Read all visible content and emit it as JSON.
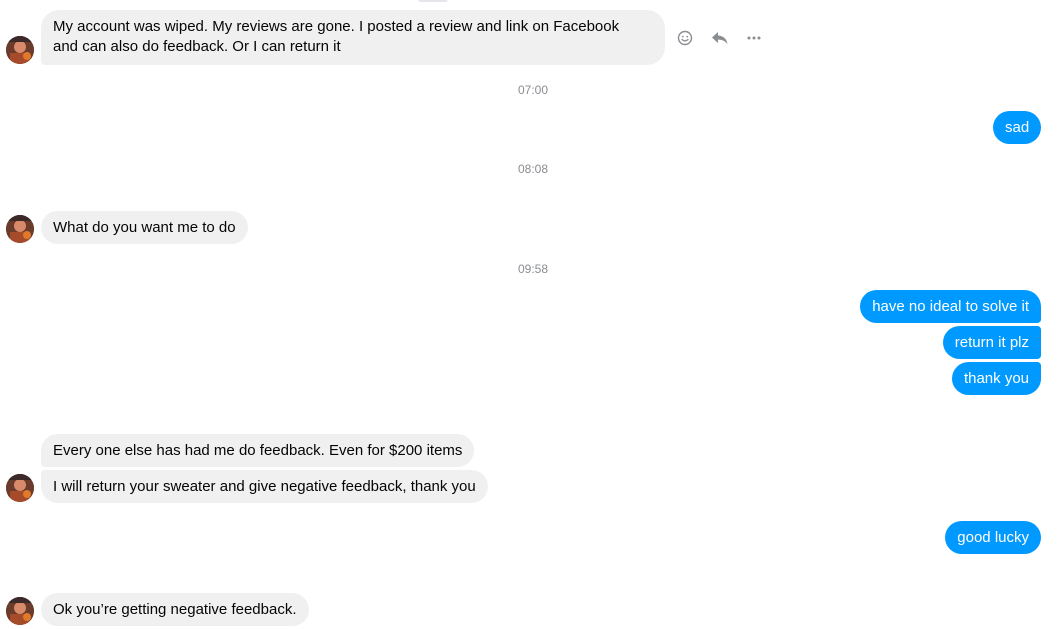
{
  "messages": [
    {
      "text_line1": "My account was wiped. My reviews are gone. I posted a review and link on Facebook",
      "text_line2": "and can also do feedback. Or I can return it"
    },
    {
      "text": "sad"
    },
    {
      "text": "What do you want me to do"
    },
    {
      "text": "have no ideal to solve it"
    },
    {
      "text": "return it plz"
    },
    {
      "text": "thank you"
    },
    {
      "text": "Every one else has had me do feedback. Even for $200 items"
    },
    {
      "text": "I will return your sweater and give negative feedback, thank you"
    },
    {
      "text": "good lucky"
    },
    {
      "text": "Ok you’re getting negative feedback."
    }
  ],
  "timestamps": [
    "07:00",
    "08:08",
    "09:58"
  ],
  "icons": {
    "react": "smiley-icon",
    "reply": "reply-icon",
    "more": "more-icon"
  },
  "colors": {
    "incoming_bubble": "#f0f0f0",
    "outgoing_bubble": "#0099ff",
    "timestamp_text": "#8a8d91",
    "action_icon": "#8a8d91"
  }
}
